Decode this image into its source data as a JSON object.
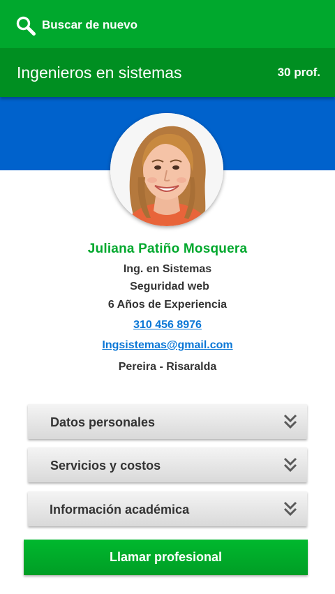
{
  "topbar": {
    "search_label": "Buscar de nuevo",
    "icon": "search-icon"
  },
  "header": {
    "title": "Ingenieros en sistemas",
    "count": "30 prof."
  },
  "colors": {
    "top_green": "#00a82d",
    "title_green": "#008f21",
    "banner_blue": "#0062cc",
    "name_green": "#00a82d",
    "link_blue": "#0b77d6"
  },
  "profile": {
    "name": "Juliana Patiño Mosquera",
    "title": "Ing. en Sistemas",
    "specialty": "Seguridad web",
    "experience": "6 Años de Experiencia",
    "phone": "310 456 8976",
    "email": "Ingsistemas@gmail.com",
    "location": "Pereira - Risaralda"
  },
  "sections": [
    {
      "label": "Datos personales",
      "icon": "chevron-double-down-icon"
    },
    {
      "label": "Servicios y costos",
      "icon": "chevron-double-down-icon"
    },
    {
      "label": "Información académica",
      "icon": "chevron-double-down-icon"
    }
  ],
  "actions": {
    "call_label": "Llamar profesional"
  }
}
